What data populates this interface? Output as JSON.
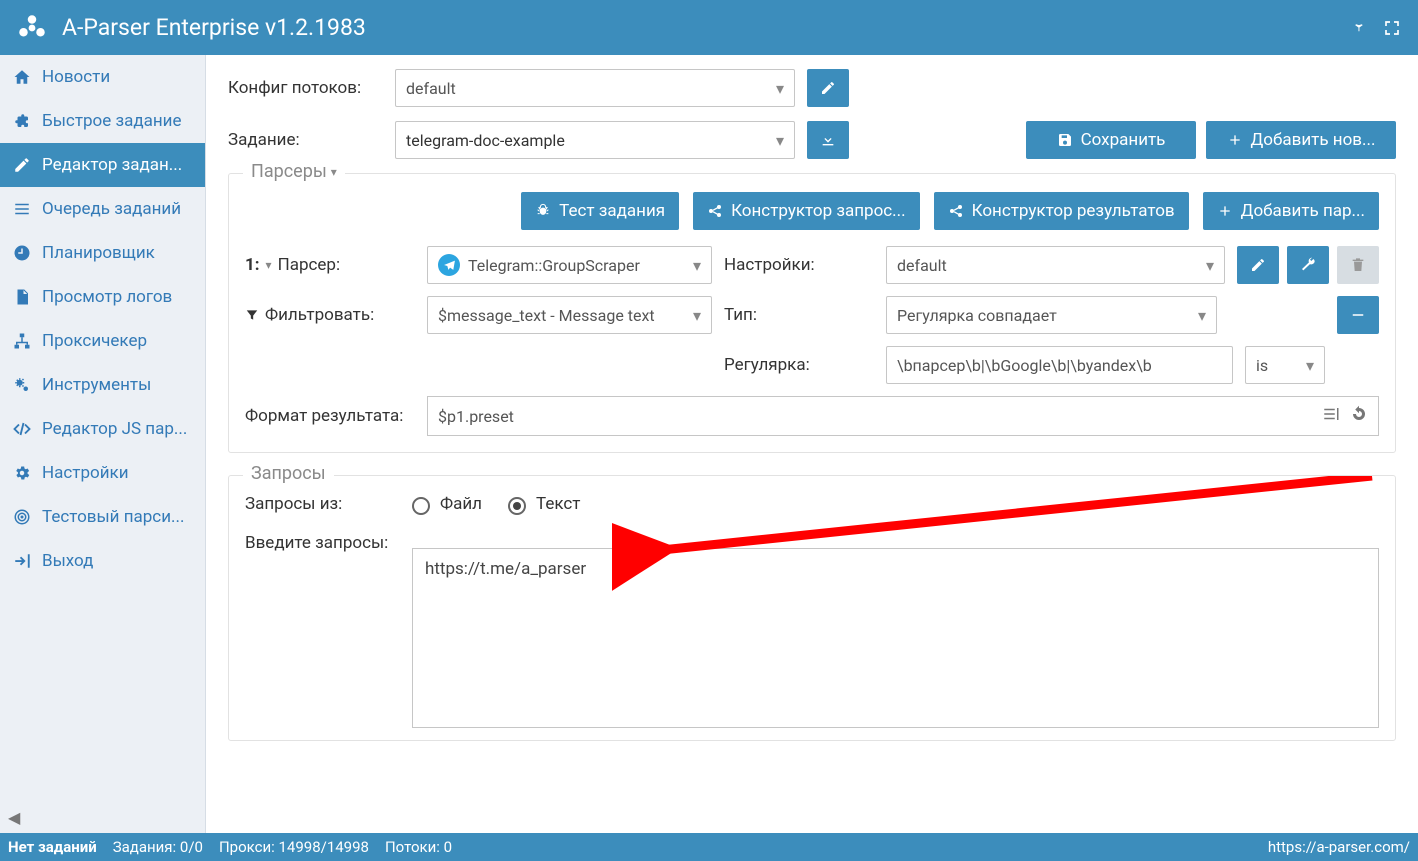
{
  "header": {
    "title": "A-Parser Enterprise v1.2.1983"
  },
  "sidebar": {
    "items": [
      {
        "label": "Новости"
      },
      {
        "label": "Быстрое задание"
      },
      {
        "label": "Редактор задан..."
      },
      {
        "label": "Очередь заданий"
      },
      {
        "label": "Планировщик"
      },
      {
        "label": "Просмотр логов"
      },
      {
        "label": "Проксичекер"
      },
      {
        "label": "Инструменты"
      },
      {
        "label": "Редактор JS пар..."
      },
      {
        "label": "Настройки"
      },
      {
        "label": "Тестовый парси..."
      },
      {
        "label": "Выход"
      }
    ]
  },
  "config_row": {
    "label": "Конфиг потоков:",
    "value": "default"
  },
  "task_row": {
    "label": "Задание:",
    "value": "telegram-doc-example"
  },
  "buttons": {
    "save": "Сохранить",
    "add_new": "Добавить нов..."
  },
  "parsers": {
    "legend": "Парсеры",
    "toolbar": {
      "test": "Тест задания",
      "req_builder": "Конструктор запрос...",
      "res_builder": "Конструктор результатов",
      "add_parser": "Добавить пар..."
    },
    "row1": {
      "index": "1:",
      "parser_label": "Парсер:",
      "parser_value": "Telegram::GroupScraper",
      "settings_label": "Настройки:",
      "settings_value": "default"
    },
    "row2": {
      "filter_label": "Фильтровать:",
      "filter_value": "$message_text - Message text",
      "type_label": "Тип:",
      "type_value": "Регулярка совпадает"
    },
    "row3": {
      "regex_label": "Регулярка:",
      "regex_value": "\\bпарсер\\b|\\bGoogle\\b|\\byandex\\b",
      "flags_value": "is"
    },
    "result": {
      "label": "Формат результата:",
      "value": "$p1.preset"
    }
  },
  "queries": {
    "legend": "Запросы",
    "from_label": "Запросы из:",
    "radio_file": "Файл",
    "radio_text": "Текст",
    "enter_label": "Введите запросы:",
    "text_value": "https://t.me/a_parser"
  },
  "status": {
    "no_tasks": "Нет заданий",
    "tasks": "Задания: 0/0",
    "proxy": "Прокси: 14998/14998",
    "threads": "Потоки: 0",
    "url": "https://a-parser.com/"
  }
}
